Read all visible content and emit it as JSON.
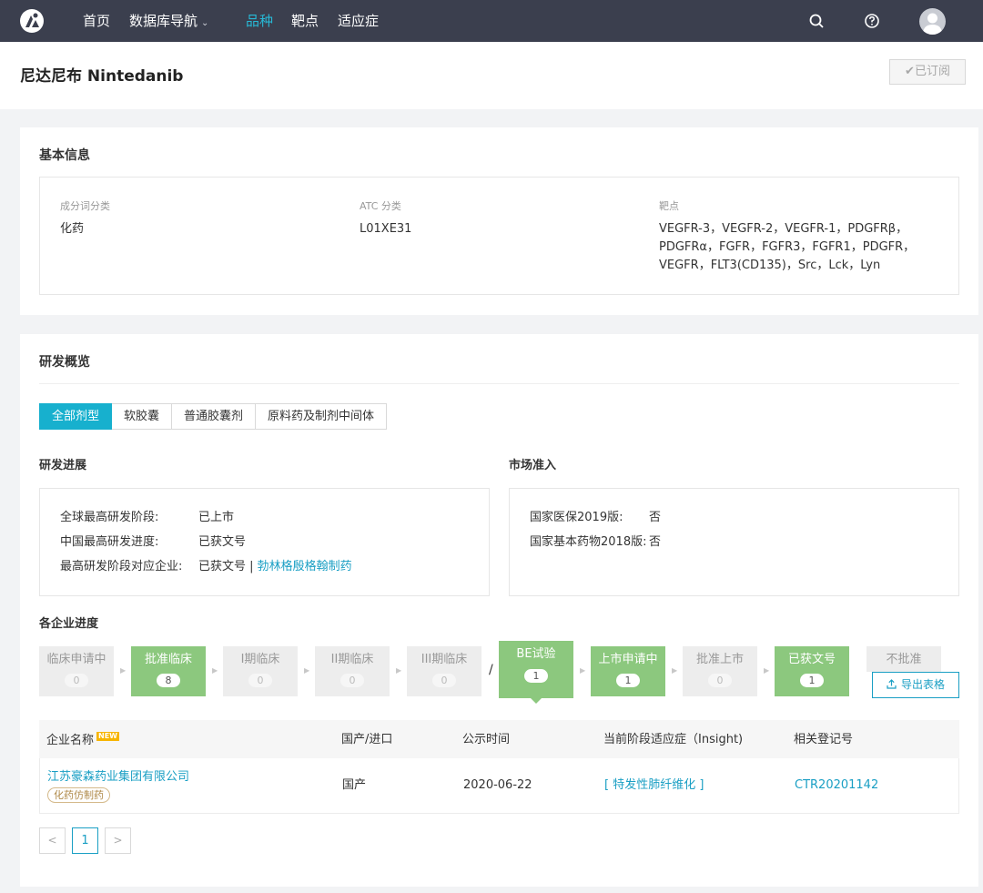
{
  "nav": {
    "home": "首页",
    "db_nav": "数据库导航",
    "db_nav_caret": "⌄",
    "variety": "品种",
    "target": "靶点",
    "indication": "适应症",
    "icons": [
      "search-icon",
      "help-icon",
      "avatar"
    ]
  },
  "page": {
    "title": "尼达尼布 Nintedanib",
    "subscribe_btn": "✔已订阅"
  },
  "basic_info": {
    "heading": "基本信息",
    "category_label": "成分词分类",
    "category_value": "化药",
    "atc_label": "ATC 分类",
    "atc_value": "L01XE31",
    "target_label": "靶点",
    "target_lines": [
      "VEGFR-3，VEGFR-2，VEGFR-1，PDGFRβ，",
      "PDGFRα，FGFR，FGFR3，FGFR1，PDGFR，",
      "VEGFR，FLT3(CD135)，Src，Lck，Lyn"
    ]
  },
  "rd": {
    "heading": "研发概览",
    "tabs": [
      "全部剂型",
      "软胶囊",
      "普通胶囊剂",
      "原料药及制剂中间体"
    ],
    "progress_heading": "研发进展",
    "progress": {
      "global_label": "全球最高研发阶段:",
      "global_value": "已上市",
      "china_label": "中国最高研发进度:",
      "china_value": "已获文号",
      "company_label": "最高研发阶段对应企业:",
      "company_value": "已获文号 |",
      "company_link": "勃林格殷格翰制药"
    },
    "market_heading": "市场准入",
    "market": {
      "insurance_label": "国家医保2019版:",
      "insurance_value": "否",
      "essential_label": "国家基本药物2018版:",
      "essential_value": "否"
    }
  },
  "enterprise": {
    "heading": "各企业进度",
    "stages": [
      {
        "name": "临床申请中",
        "count": "0"
      },
      {
        "name": "批准临床",
        "count": "8"
      },
      {
        "name": "I期临床",
        "count": "0"
      },
      {
        "name": "II期临床",
        "count": "0"
      },
      {
        "name": "III期临床",
        "count": "0"
      },
      {
        "name": "BE试验",
        "count": "1"
      },
      {
        "name": "上市申请中",
        "count": "1"
      },
      {
        "name": "批准上市",
        "count": "0"
      },
      {
        "name": "已获文号",
        "count": "1"
      },
      {
        "name": "不批准",
        "count": ""
      }
    ],
    "slash": "/",
    "export_btn": "导出表格",
    "table": {
      "headers": [
        "企业名称",
        "国产/进口",
        "公示时间",
        "当前阶段适应症（Insight)",
        "相关登记号"
      ],
      "new_badge": "NEW",
      "rows": [
        {
          "company": "江苏豪森药业集团有限公司",
          "tag": "化药仿制药",
          "origin": "国产",
          "date": "2020-06-22",
          "indication": "[ 特发性肺纤维化 ]",
          "reg_no": "CTR20201142"
        }
      ]
    },
    "pagination": {
      "prev": "<",
      "current": "1",
      "next": ">"
    }
  }
}
